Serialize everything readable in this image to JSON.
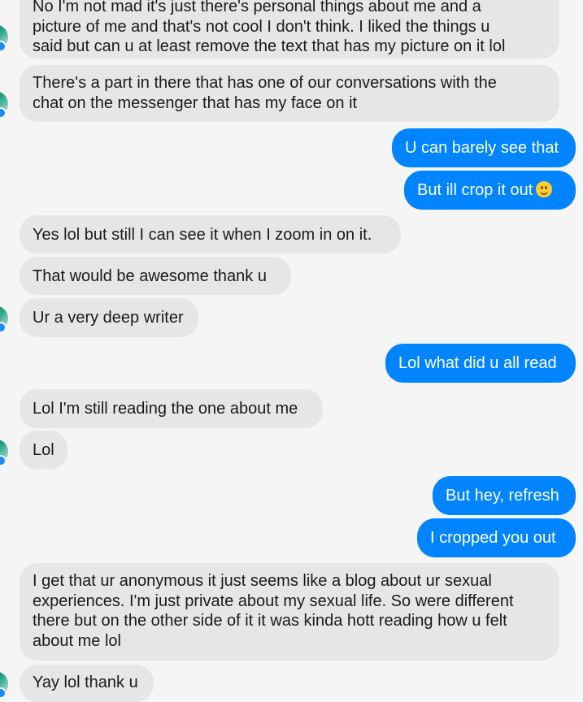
{
  "messages": [
    {
      "side": "in",
      "lines": [
        "No I'm not mad it's just there's personal things about me and a",
        "picture of me and that's not cool I don't think. I liked the things u",
        "said but can u at least remove the text that has my picture on it lol"
      ]
    },
    {
      "side": "in",
      "lines": [
        "There's a part in there that has one of our conversations with the",
        "chat on the messenger that has my face on it"
      ]
    },
    {
      "side": "out",
      "lines": [
        "U can barely see that"
      ]
    },
    {
      "side": "out",
      "lines": [
        "But ill crop it out"
      ],
      "emoji": "smiling-face-icon"
    },
    {
      "side": "in",
      "lines": [
        "Yes lol but still I can see it when I zoom in on it."
      ]
    },
    {
      "side": "in",
      "lines": [
        "That would be awesome thank u"
      ]
    },
    {
      "side": "in",
      "lines": [
        "Ur a very deep writer"
      ]
    },
    {
      "side": "out",
      "lines": [
        "Lol what did u all read"
      ]
    },
    {
      "side": "in",
      "lines": [
        "Lol I'm still reading the one about me"
      ]
    },
    {
      "side": "in",
      "lines": [
        "Lol"
      ]
    },
    {
      "side": "out",
      "lines": [
        "But hey, refresh"
      ]
    },
    {
      "side": "out",
      "lines": [
        "I cropped you out"
      ]
    },
    {
      "side": "in",
      "lines": [
        "I get that ur anonymous it just seems like a blog about ur sexual",
        "experiences. I'm just private about my sexual life. So were different",
        "there but on the other side of it it was kinda hott reading how u  felt",
        "about me lol"
      ]
    },
    {
      "side": "in",
      "lines": [
        "Yay lol thank u"
      ]
    }
  ],
  "colors": {
    "incoming_bubble": "#e6e6e6",
    "outgoing_bubble": "#0084ff",
    "background": "#f5f5f5"
  }
}
